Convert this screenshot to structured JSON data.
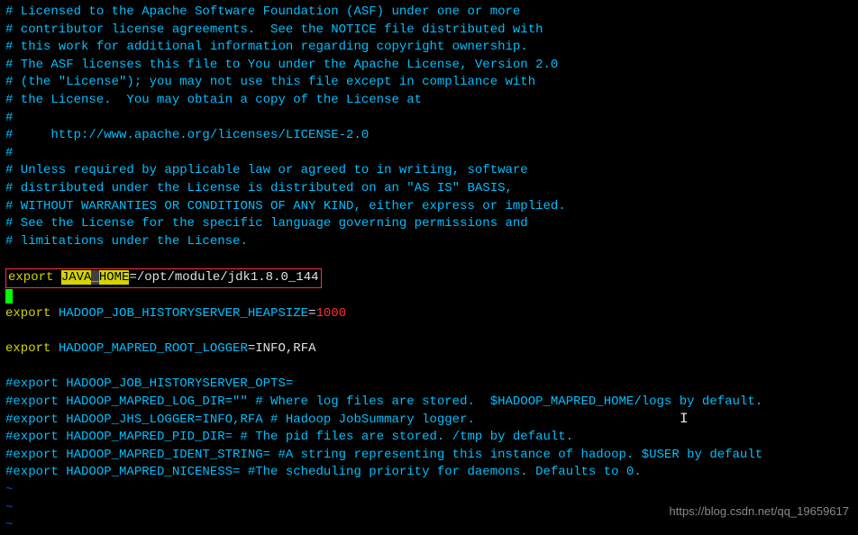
{
  "comments": [
    "# Licensed to the Apache Software Foundation (ASF) under one or more",
    "# contributor license agreements.  See the NOTICE file distributed with",
    "# this work for additional information regarding copyright ownership.",
    "# The ASF licenses this file to You under the Apache License, Version 2.0",
    "# (the \"License\"); you may not use this file except in compliance with",
    "# the License.  You may obtain a copy of the License at",
    "#",
    "#     http://www.apache.org/licenses/LICENSE-2.0",
    "#",
    "# Unless required by applicable law or agreed to in writing, software",
    "# distributed under the License is distributed on an \"AS IS\" BASIS,",
    "# WITHOUT WARRANTIES OR CONDITIONS OF ANY KIND, either express or implied.",
    "# See the License for the specific language governing permissions and",
    "# limitations under the License."
  ],
  "export1": {
    "keyword": "export",
    "java": "JAVA",
    "sep": "_",
    "home": "HOME",
    "eq": "=",
    "value": "/opt/module/jdk1.8.0_144"
  },
  "export2": {
    "keyword": "export",
    "var": "HADOOP_JOB_HISTORYSERVER_HEAPSIZE",
    "eq": "=",
    "value": "1000"
  },
  "export3": {
    "keyword": "export",
    "var": "HADOOP_MAPRED_ROOT_LOGGER",
    "eq": "=",
    "value": "INFO,RFA"
  },
  "comments2": [
    "#export HADOOP_JOB_HISTORYSERVER_OPTS=",
    "#export HADOOP_MAPRED_LOG_DIR=\"\" # Where log files are stored.  $HADOOP_MAPRED_HOME/logs by default.",
    "#export HADOOP_JHS_LOGGER=INFO,RFA # Hadoop JobSummary logger.",
    "#export HADOOP_MAPRED_PID_DIR= # The pid files are stored. /tmp by default.",
    "#export HADOOP_MAPRED_IDENT_STRING= #A string representing this instance of hadoop. $USER by default",
    "#export HADOOP_MAPRED_NICENESS= #The scheduling priority for daemons. Defaults to 0."
  ],
  "tilde": "~",
  "watermark": "https://blog.csdn.net/qq_19659617",
  "cursor_icon": "I"
}
